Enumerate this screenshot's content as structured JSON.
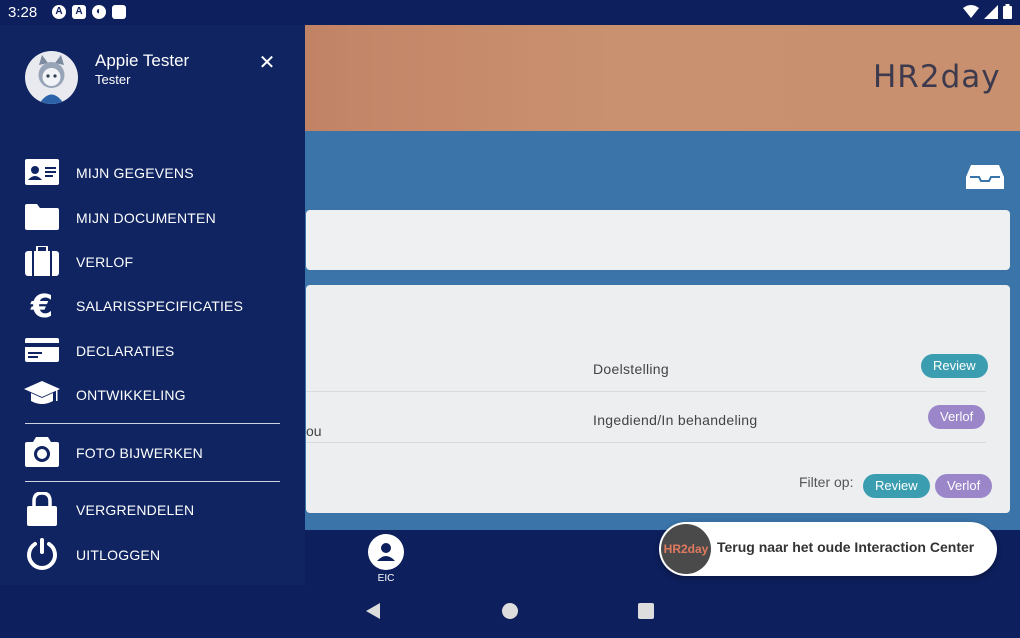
{
  "status_bar": {
    "time": "3:28"
  },
  "app": {
    "logo": "HR2day",
    "row1_status": "Doelstelling",
    "row1_pill": "Review",
    "row2_truncated": "ou",
    "row2_status": "Ingediend/In behandeling",
    "row2_pill": "Verlof",
    "filter_label": "Filter op:",
    "filter_review": "Review",
    "filter_verlof": "Verlof",
    "bottom_nav_label": "EIC",
    "toast_logo": "HR2day",
    "toast_text": "Terug naar het oude Interaction Center",
    "colors": {
      "primary": "#0d1f5c",
      "review": "#3b9eb0",
      "verlof": "#9a86c8"
    }
  },
  "drawer": {
    "user_name": "Appie Tester",
    "user_role": "Tester",
    "items": [
      {
        "label": "MIJN GEGEVENS",
        "icon": "id-card-icon"
      },
      {
        "label": "MIJN DOCUMENTEN",
        "icon": "folder-icon"
      },
      {
        "label": "VERLOF",
        "icon": "suitcase-icon"
      },
      {
        "label": "SALARISSPECIFICATIES",
        "icon": "euro-icon"
      },
      {
        "label": "DECLARATIES",
        "icon": "credit-card-icon"
      },
      {
        "label": "ONTWIKKELING",
        "icon": "graduation-cap-icon"
      },
      {
        "label": "FOTO BIJWERKEN",
        "icon": "camera-icon"
      },
      {
        "label": "VERGRENDELEN",
        "icon": "lock-icon"
      },
      {
        "label": "UITLOGGEN",
        "icon": "power-icon"
      }
    ]
  }
}
